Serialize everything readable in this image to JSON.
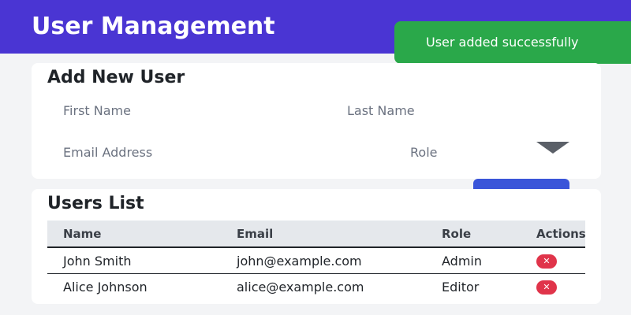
{
  "header": {
    "title": "User Management"
  },
  "toast": {
    "message": "User added successfully"
  },
  "add_user_form": {
    "title": "Add New User",
    "first_name_placeholder": "First Name",
    "last_name_placeholder": "Last Name",
    "email_placeholder": "Email Address",
    "role_placeholder": "Role"
  },
  "users_list": {
    "title": "Users List",
    "columns": [
      "Name",
      "Email",
      "Role",
      "Actions"
    ],
    "rows": [
      {
        "name": "John Smith",
        "email": "john@example.com",
        "role": "Admin",
        "action_icon": "close-icon"
      },
      {
        "name": "Alice Johnson",
        "email": "alice@example.com",
        "role": "Editor",
        "action_icon": "close-icon"
      }
    ]
  },
  "colors": {
    "header_bg": "#4a35d3",
    "toast_bg": "#2aa84a",
    "primary_button": "#3a55d9",
    "delete_button": "#e0344a"
  }
}
